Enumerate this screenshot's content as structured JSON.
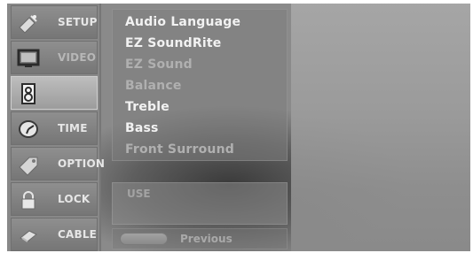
{
  "sidebar": {
    "items": [
      {
        "label": "SETUP",
        "icon": "satellite-dish-icon",
        "active": false
      },
      {
        "label": "VIDEO",
        "icon": "tv-icon",
        "active": false
      },
      {
        "label": "",
        "icon": "speaker-icon",
        "active": true
      },
      {
        "label": "TIME",
        "icon": "clock-icon",
        "active": false
      },
      {
        "label": "OPTION",
        "icon": "tag-icon",
        "active": false
      },
      {
        "label": "LOCK",
        "icon": "lock-icon",
        "active": false
      },
      {
        "label": "CABLE",
        "icon": "cable-icon",
        "active": false
      }
    ]
  },
  "menu": {
    "items": [
      {
        "label": "Audio Language",
        "enabled": true
      },
      {
        "label": "EZ SoundRite",
        "enabled": true
      },
      {
        "label": "EZ Sound",
        "enabled": false
      },
      {
        "label": "Balance",
        "enabled": false
      },
      {
        "label": "Treble",
        "enabled": true
      },
      {
        "label": "Bass",
        "enabled": true
      },
      {
        "label": "Front Surround",
        "enabled": false
      }
    ]
  },
  "sub_panel": {
    "text": "USE"
  },
  "bottom": {
    "previous_label": "Previous"
  },
  "colors": {
    "menu_text": "#f2f2f2",
    "menu_text_dim": "#b0b0b0",
    "active_bg": "#bdbdbd"
  }
}
